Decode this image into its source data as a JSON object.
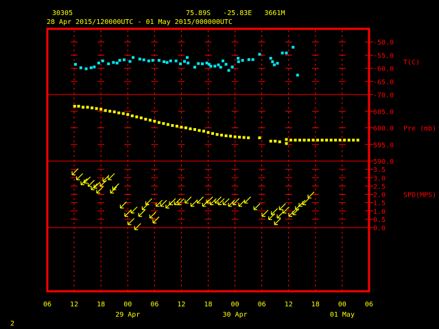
{
  "header": {
    "station_id": "30305",
    "location": "75.89S   -25.83E   3661M",
    "time_range": "28 Apr 2015/120000UTC - 01 May 2015/000000UTC"
  },
  "footer": {
    "page_number": "2"
  },
  "colors": {
    "background": "#000000",
    "frame": "#ff0000",
    "grid": "#ff0000",
    "text": "#ffff00",
    "temperature": "#00e5ee",
    "pressure": "#ffff00",
    "wind": "#ffff00"
  },
  "chart_data": {
    "type": "scatter",
    "x_axis": {
      "start_hour": 0,
      "end_hour": 72,
      "tick_hours": [
        0,
        6,
        12,
        18,
        24,
        30,
        36,
        42,
        48,
        54,
        60,
        66,
        72
      ],
      "tick_labels": [
        "06",
        "12",
        "18",
        "00",
        "06",
        "12",
        "18",
        "00",
        "06",
        "12",
        "18",
        "00",
        "06"
      ],
      "date_labels": [
        {
          "hour": 18,
          "text": "29 Apr"
        },
        {
          "hour": 42,
          "text": "30 Apr"
        },
        {
          "hour": 66,
          "text": "01 May"
        }
      ]
    },
    "panels": [
      {
        "name": "temperature",
        "label": "T(C)",
        "ylim": [
          -70,
          -45
        ],
        "ticks": [
          -70,
          -65,
          -60,
          -55,
          -50
        ],
        "tick_labels": [
          "-70.0",
          "-65.0",
          "-60.0",
          "-55.0",
          "-50.0"
        ],
        "label_value": -57.5,
        "points": [
          [
            6.3,
            -58.5
          ],
          [
            7.5,
            -59.8
          ],
          [
            8.7,
            -60.2
          ],
          [
            9.8,
            -59.8
          ],
          [
            10.5,
            -59.5
          ],
          [
            11.5,
            -58.0
          ],
          [
            12.4,
            -57.2
          ],
          [
            13.7,
            -58.3
          ],
          [
            14.8,
            -57.8
          ],
          [
            15.6,
            -58.0
          ],
          [
            16.2,
            -57.0
          ],
          [
            17.2,
            -56.8
          ],
          [
            18.5,
            -57.4
          ],
          [
            19.2,
            -55.9
          ],
          [
            20.7,
            -56.5
          ],
          [
            21.6,
            -56.8
          ],
          [
            22.7,
            -57.2
          ],
          [
            23.6,
            -57.0
          ],
          [
            25.0,
            -57.0
          ],
          [
            26.1,
            -57.5
          ],
          [
            26.8,
            -57.8
          ],
          [
            27.6,
            -57.2
          ],
          [
            28.8,
            -57.2
          ],
          [
            29.8,
            -58.3
          ],
          [
            30.7,
            -57.4
          ],
          [
            31.3,
            -55.9
          ],
          [
            31.5,
            -58.0
          ],
          [
            33.0,
            -59.6
          ],
          [
            33.8,
            -58.2
          ],
          [
            34.7,
            -58.3
          ],
          [
            35.7,
            -58.0
          ],
          [
            36.2,
            -58.5
          ],
          [
            36.6,
            -59.2
          ],
          [
            37.5,
            -59.2
          ],
          [
            38.3,
            -58.7
          ],
          [
            38.8,
            -59.6
          ],
          [
            39.3,
            -57.2
          ],
          [
            40.0,
            -58.5
          ],
          [
            40.6,
            -60.8
          ],
          [
            41.4,
            -59.5
          ],
          [
            42.7,
            -56.2
          ],
          [
            42.8,
            -57.5
          ],
          [
            43.7,
            -57.0
          ],
          [
            45.1,
            -56.7
          ],
          [
            46.0,
            -56.7
          ],
          [
            47.5,
            -54.7
          ],
          [
            50.0,
            -56.2
          ],
          [
            50.4,
            -57.5
          ],
          [
            50.8,
            -58.7
          ],
          [
            51.5,
            -58.1
          ],
          [
            52.6,
            -54.2
          ],
          [
            53.5,
            -54.2
          ],
          [
            55.0,
            -52.0
          ],
          [
            56.0,
            -62.6
          ]
        ]
      },
      {
        "name": "pressure",
        "label": "Pre (mb)",
        "ylim": [
          590,
          610
        ],
        "ticks": [
          590,
          595,
          600,
          605
        ],
        "tick_labels": [
          "590.0",
          "595.0",
          "600.0",
          "605.0"
        ],
        "label_value": 600,
        "points": [
          [
            6.1,
            606.5
          ],
          [
            7.0,
            606.5
          ],
          [
            8.0,
            606.2
          ],
          [
            9.0,
            606.2
          ],
          [
            10.0,
            606.0
          ],
          [
            11.0,
            605.8
          ],
          [
            12.0,
            605.6
          ],
          [
            13.0,
            605.2
          ],
          [
            14.0,
            605.0
          ],
          [
            15.0,
            604.8
          ],
          [
            16.0,
            604.5
          ],
          [
            17.0,
            604.3
          ],
          [
            18.0,
            604.0
          ],
          [
            19.0,
            603.6
          ],
          [
            20.0,
            603.3
          ],
          [
            21.0,
            603.0
          ],
          [
            22.0,
            602.6
          ],
          [
            23.0,
            602.3
          ],
          [
            24.0,
            602.0
          ],
          [
            25.0,
            601.6
          ],
          [
            26.0,
            601.3
          ],
          [
            27.0,
            601.0
          ],
          [
            28.0,
            600.7
          ],
          [
            29.0,
            600.5
          ],
          [
            30.0,
            600.2
          ],
          [
            31.0,
            600.0
          ],
          [
            32.0,
            599.7
          ],
          [
            33.0,
            599.5
          ],
          [
            34.0,
            599.2
          ],
          [
            35.0,
            599.0
          ],
          [
            36.0,
            598.6
          ],
          [
            37.0,
            598.3
          ],
          [
            38.0,
            598.0
          ],
          [
            39.0,
            597.8
          ],
          [
            40.0,
            597.6
          ],
          [
            41.0,
            597.5
          ],
          [
            42.0,
            597.3
          ],
          [
            43.0,
            597.2
          ],
          [
            44.0,
            597.1
          ],
          [
            45.0,
            597.0
          ],
          [
            47.5,
            597.0
          ],
          [
            50.0,
            596.0
          ],
          [
            51.0,
            596.0
          ],
          [
            52.0,
            595.8
          ],
          [
            53.5,
            596.5
          ],
          [
            53.5,
            595.3
          ],
          [
            54.5,
            596.3
          ],
          [
            55.5,
            596.3
          ],
          [
            56.5,
            596.3
          ],
          [
            57.5,
            596.3
          ],
          [
            58.5,
            596.3
          ],
          [
            59.5,
            596.3
          ],
          [
            60.5,
            596.3
          ],
          [
            61.5,
            596.3
          ],
          [
            62.5,
            596.3
          ],
          [
            63.5,
            596.3
          ],
          [
            64.5,
            596.3
          ],
          [
            65.5,
            596.3
          ],
          [
            66.5,
            596.3
          ],
          [
            67.5,
            596.3
          ],
          [
            68.5,
            596.3
          ],
          [
            69.5,
            596.3
          ]
        ]
      },
      {
        "name": "wind_speed",
        "label": "SPD(MPS)",
        "ylim": [
          0,
          4
        ],
        "ticks": [
          0,
          0.5,
          1,
          1.5,
          2,
          2.5,
          3,
          3.5
        ],
        "tick_labels": [
          "0.0",
          "0.5",
          "1.0",
          "1.5",
          "2.0",
          "2.5",
          "3.0",
          "3.5"
        ],
        "label_value": 2,
        "points": [
          [
            6.0,
            3.3
          ],
          [
            7.0,
            3.0
          ],
          [
            8.0,
            2.7
          ],
          [
            8.7,
            2.8
          ],
          [
            9.6,
            2.6
          ],
          [
            10.3,
            2.4
          ],
          [
            10.9,
            2.5
          ],
          [
            11.5,
            2.2
          ],
          [
            12.3,
            2.6
          ],
          [
            12.9,
            2.9
          ],
          [
            14.1,
            3.0
          ],
          [
            14.6,
            2.2
          ],
          [
            15.1,
            2.4
          ],
          [
            16.8,
            1.3
          ],
          [
            17.8,
            0.8
          ],
          [
            18.5,
            0.3
          ],
          [
            19.2,
            1.0
          ],
          [
            20.0,
            0.0
          ],
          [
            20.9,
            0.8
          ],
          [
            21.7,
            1.2
          ],
          [
            22.5,
            1.5
          ],
          [
            23.4,
            0.7
          ],
          [
            24.1,
            0.4
          ],
          [
            24.8,
            1.4
          ],
          [
            25.8,
            1.4
          ],
          [
            27.0,
            1.3
          ],
          [
            27.8,
            1.5
          ],
          [
            28.9,
            1.5
          ],
          [
            29.7,
            1.5
          ],
          [
            31.3,
            1.6
          ],
          [
            32.6,
            1.4
          ],
          [
            34.0,
            1.6
          ],
          [
            35.2,
            1.4
          ],
          [
            36.1,
            1.6
          ],
          [
            36.9,
            1.5
          ],
          [
            38.0,
            1.6
          ],
          [
            38.7,
            1.5
          ],
          [
            39.8,
            1.5
          ],
          [
            41.0,
            1.4
          ],
          [
            42.0,
            1.5
          ],
          [
            43.3,
            1.4
          ],
          [
            44.6,
            1.6
          ],
          [
            46.7,
            1.2
          ],
          [
            48.5,
            0.8
          ],
          [
            50.0,
            0.6
          ],
          [
            50.6,
            0.9
          ],
          [
            51.3,
            0.3
          ],
          [
            51.9,
            0.7
          ],
          [
            52.4,
            1.2
          ],
          [
            53.2,
            1.0
          ],
          [
            54.5,
            0.8
          ],
          [
            55.4,
            0.9
          ],
          [
            56.0,
            1.2
          ],
          [
            56.8,
            1.4
          ],
          [
            57.6,
            1.5
          ],
          [
            58.8,
            1.9
          ]
        ]
      }
    ]
  }
}
